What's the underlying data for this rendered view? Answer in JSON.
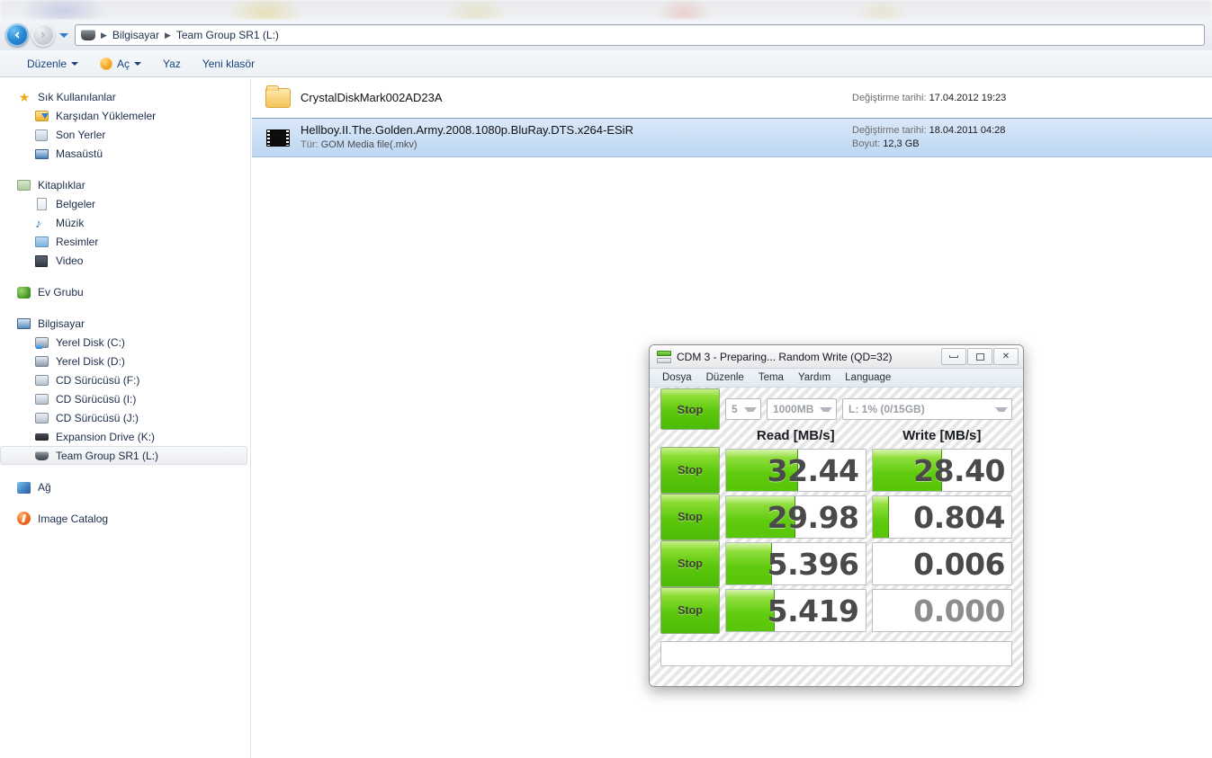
{
  "explorer": {
    "nav": {
      "back_title": "Geri",
      "forward_title": "İleri",
      "breadcrumb": [
        "Bilgisayar",
        "Team Group SR1  (L:)"
      ]
    },
    "toolbar": {
      "organize": "Düzenle",
      "open": "Aç",
      "burn": "Yaz",
      "new_folder": "Yeni klasör"
    },
    "sidebar": [
      {
        "label": "Sık Kullanılanlar",
        "icon": "star-icon",
        "level": "top"
      },
      {
        "label": "Karşıdan Yüklemeler",
        "icon": "downloads-folder-icon",
        "level": "child"
      },
      {
        "label": "Son Yerler",
        "icon": "recent-places-icon",
        "level": "child"
      },
      {
        "label": "Masaüstü",
        "icon": "desktop-icon",
        "level": "child"
      },
      {
        "label": "Kitaplıklar",
        "icon": "libraries-icon",
        "level": "top",
        "gap_before": true
      },
      {
        "label": "Belgeler",
        "icon": "documents-icon",
        "level": "child"
      },
      {
        "label": "Müzik",
        "icon": "music-note-icon",
        "level": "child"
      },
      {
        "label": "Resimler",
        "icon": "pictures-icon",
        "level": "child"
      },
      {
        "label": "Video",
        "icon": "video-icon",
        "level": "child"
      },
      {
        "label": "Ev Grubu",
        "icon": "homegroup-icon",
        "level": "top",
        "gap_before": true
      },
      {
        "label": "Bilgisayar",
        "icon": "computer-icon",
        "level": "top",
        "gap_before": true
      },
      {
        "label": "Yerel Disk (C:)",
        "icon": "system-drive-icon",
        "level": "child"
      },
      {
        "label": "Yerel Disk (D:)",
        "icon": "hard-drive-icon",
        "level": "child"
      },
      {
        "label": "CD Sürücüsü (F:)",
        "icon": "cd-drive-icon",
        "level": "child"
      },
      {
        "label": "CD Sürücüsü (I:)",
        "icon": "cd-drive-icon",
        "level": "child"
      },
      {
        "label": "CD Sürücüsü (J:)",
        "icon": "cd-drive-icon",
        "level": "child"
      },
      {
        "label": "Expansion Drive (K:)",
        "icon": "external-drive-icon",
        "level": "child"
      },
      {
        "label": "Team Group SR1  (L:)",
        "icon": "usb-drive-icon",
        "level": "child",
        "selected": true
      },
      {
        "label": "Ağ",
        "icon": "network-icon",
        "level": "top",
        "gap_before": true
      },
      {
        "label": "Image Catalog",
        "icon": "image-catalog-icon",
        "level": "top",
        "gap_before": true
      }
    ],
    "files": [
      {
        "name": "CrystalDiskMark002AD23A",
        "icon": "folder-icon",
        "subtitle": "",
        "date_label": "Değiştirme tarihi:",
        "date_value": "17.04.2012 19:23",
        "size_label": "",
        "size_value": "",
        "selected": false
      },
      {
        "name": "Hellboy.II.The.Golden.Army.2008.1080p.BluRay.DTS.x264-ESiR",
        "icon": "video-file-icon",
        "subtitle_label": "Tür:",
        "subtitle_value": "GOM Media file(.mkv)",
        "date_label": "Değiştirme tarihi:",
        "date_value": "18.04.2011 04:28",
        "size_label": "Boyut:",
        "size_value": "12,3 GB",
        "selected": true
      }
    ]
  },
  "cdm": {
    "title": "CDM 3 - Preparing... Random Write (QD=32)",
    "window_buttons": {
      "minimize": "minimize-button",
      "maximize": "maximize-button",
      "close": "✕"
    },
    "menu": [
      "Dosya",
      "Düzenle",
      "Tema",
      "Yardım",
      "Language"
    ],
    "controls": {
      "all_button": "Stop",
      "runs": "5",
      "test_size": "1000MB",
      "target_drive": "L: 1% (0/15GB)"
    },
    "headers": {
      "read": "Read [MB/s]",
      "write": "Write [MB/s]"
    },
    "rows": [
      {
        "button": "Stop",
        "read": "32.44",
        "write": "28.40",
        "read_fill_pct": 52,
        "write_fill_pct": 50
      },
      {
        "button": "Stop",
        "read": "29.98",
        "write": "0.804",
        "read_fill_pct": 50,
        "write_fill_pct": 12
      },
      {
        "button": "Stop",
        "read": "5.396",
        "write": "0.006",
        "read_fill_pct": 33,
        "write_fill_pct": 0
      },
      {
        "button": "Stop",
        "read": "5.419",
        "write": "0.000",
        "read_fill_pct": 35,
        "write_fill_pct": 0,
        "write_dim": true
      }
    ],
    "status_text": ""
  },
  "colors": {
    "accent_green": "#5cc70b",
    "selection_blue": "#cbdff6",
    "link_blue": "#15417e"
  }
}
